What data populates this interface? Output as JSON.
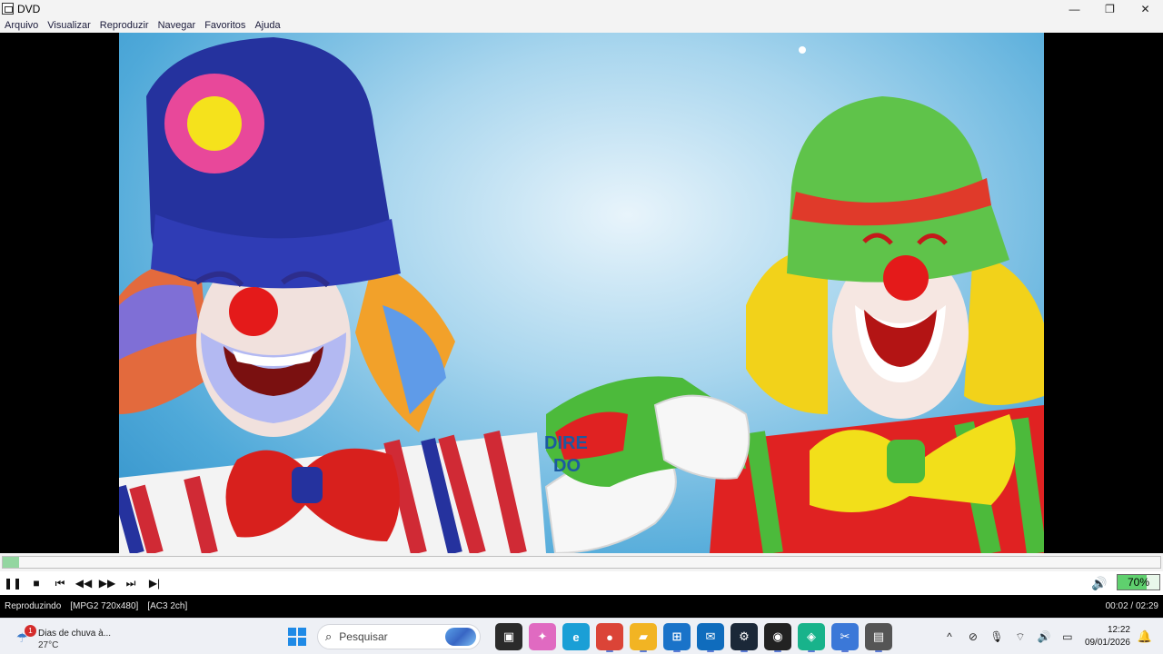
{
  "window": {
    "title": "DVD",
    "minimize": "—",
    "restore": "❐",
    "close": "✕"
  },
  "menu": [
    "Arquivo",
    "Visualizar",
    "Reproduzir",
    "Navegar",
    "Favoritos",
    "Ajuda"
  ],
  "video": {
    "visible_text": [
      "DIRE",
      "DO"
    ]
  },
  "seek": {
    "progress_fraction": 0.014
  },
  "controls": {
    "pause": "❚❚",
    "stop": "■",
    "prev": "⏮",
    "rewind": "◀◀",
    "forward": "▶▶",
    "next": "⏭",
    "step": "▶|",
    "volume_icon": "🔊",
    "volume_label": "70%",
    "volume_level": 0.7
  },
  "status": {
    "state": "Reproduzindo",
    "video_info": "[MPG2 720x480]",
    "audio_info": "[AC3 2ch]",
    "time": "00:02 / 02:29"
  },
  "taskbar": {
    "weather_title": "Dias de chuva à...",
    "weather_temp": "27°C",
    "weather_badge": "1",
    "search_placeholder": "Pesquisar",
    "apps": [
      {
        "name": "task-view",
        "glyph": "▣",
        "color": "#2b2b2b"
      },
      {
        "name": "copilot",
        "glyph": "✦",
        "color": "#e06ac1"
      },
      {
        "name": "edge",
        "glyph": "e",
        "color": "#1a9fd6"
      },
      {
        "name": "chrome",
        "glyph": "●",
        "color": "#db4437"
      },
      {
        "name": "file-explorer",
        "glyph": "▰",
        "color": "#f2b423"
      },
      {
        "name": "microsoft-store",
        "glyph": "⊞",
        "color": "#1a73c9"
      },
      {
        "name": "outlook",
        "glyph": "✉",
        "color": "#0f6cbd"
      },
      {
        "name": "steam",
        "glyph": "⚙",
        "color": "#1b2838"
      },
      {
        "name": "app-dark",
        "glyph": "◉",
        "color": "#222222"
      },
      {
        "name": "app-green",
        "glyph": "◈",
        "color": "#18b38b"
      },
      {
        "name": "snipping-tool",
        "glyph": "✂",
        "color": "#3b78d8"
      },
      {
        "name": "dvd-player",
        "glyph": "▤",
        "color": "#555555"
      }
    ],
    "tray": {
      "chevron": "^",
      "network_off": "⊘",
      "mic": "🎙",
      "wifi": "⌔",
      "volume": "🔊",
      "battery": "▭"
    },
    "clock_time": "12:22",
    "clock_date": "09/01/2026",
    "notification": "🔔"
  }
}
